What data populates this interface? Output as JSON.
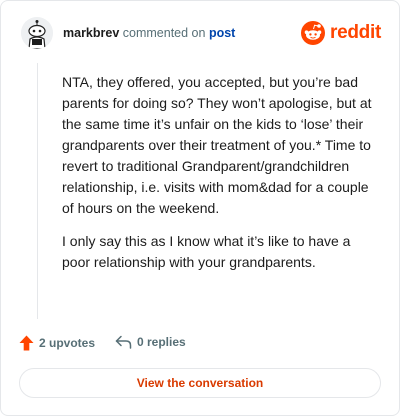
{
  "header": {
    "username": "markbrev",
    "commented_on": "commented on",
    "post_link": "post",
    "logo_text": "reddit"
  },
  "comment": {
    "paragraphs": [
      "NTA, they offered, you accepted, but you’re bad parents for doing so? They won’t apologise, but at the same time it’s unfair on the kids to ‘lose’ their grandparents over their treatment of you.* Time to revert to traditional Grandparent/grandchildren relationship, i.e. visits with mom&dad for a couple of hours on the weekend.",
      "I only say this as I know what it’s like to have a poor relationship with your grandparents."
    ]
  },
  "actions": {
    "upvotes_label": "2 upvotes",
    "replies_label": "0 replies"
  },
  "footer": {
    "view_conversation_label": "View the conversation"
  },
  "colors": {
    "brand": "#ff4500",
    "link": "#0045ac",
    "muted": "#576f76",
    "button_text": "#d93a00"
  },
  "icons": [
    "avatar",
    "reddit-logo-icon",
    "upvote-arrow-icon",
    "reply-icon"
  ]
}
